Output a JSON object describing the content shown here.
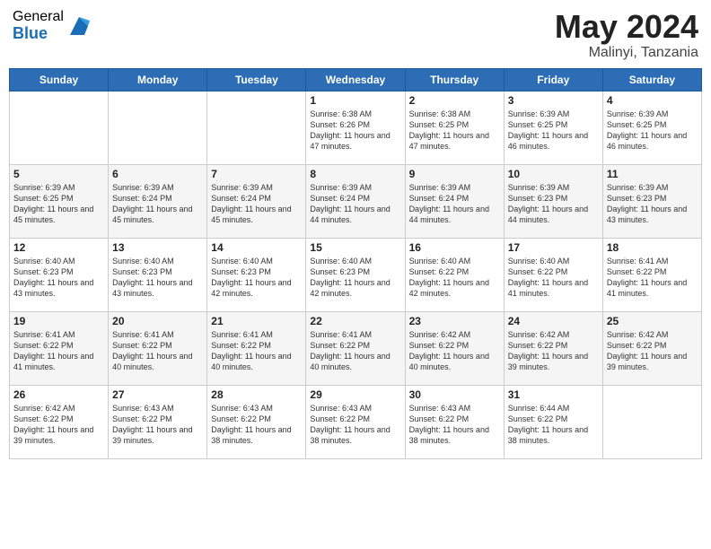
{
  "logo": {
    "general": "General",
    "blue": "Blue"
  },
  "title": {
    "month": "May 2024",
    "location": "Malinyi, Tanzania"
  },
  "headers": [
    "Sunday",
    "Monday",
    "Tuesday",
    "Wednesday",
    "Thursday",
    "Friday",
    "Saturday"
  ],
  "weeks": [
    [
      {
        "day": "",
        "text": ""
      },
      {
        "day": "",
        "text": ""
      },
      {
        "day": "",
        "text": ""
      },
      {
        "day": "1",
        "text": "Sunrise: 6:38 AM\nSunset: 6:26 PM\nDaylight: 11 hours\nand 47 minutes."
      },
      {
        "day": "2",
        "text": "Sunrise: 6:38 AM\nSunset: 6:25 PM\nDaylight: 11 hours\nand 47 minutes."
      },
      {
        "day": "3",
        "text": "Sunrise: 6:39 AM\nSunset: 6:25 PM\nDaylight: 11 hours\nand 46 minutes."
      },
      {
        "day": "4",
        "text": "Sunrise: 6:39 AM\nSunset: 6:25 PM\nDaylight: 11 hours\nand 46 minutes."
      }
    ],
    [
      {
        "day": "5",
        "text": "Sunrise: 6:39 AM\nSunset: 6:25 PM\nDaylight: 11 hours\nand 45 minutes."
      },
      {
        "day": "6",
        "text": "Sunrise: 6:39 AM\nSunset: 6:24 PM\nDaylight: 11 hours\nand 45 minutes."
      },
      {
        "day": "7",
        "text": "Sunrise: 6:39 AM\nSunset: 6:24 PM\nDaylight: 11 hours\nand 45 minutes."
      },
      {
        "day": "8",
        "text": "Sunrise: 6:39 AM\nSunset: 6:24 PM\nDaylight: 11 hours\nand 44 minutes."
      },
      {
        "day": "9",
        "text": "Sunrise: 6:39 AM\nSunset: 6:24 PM\nDaylight: 11 hours\nand 44 minutes."
      },
      {
        "day": "10",
        "text": "Sunrise: 6:39 AM\nSunset: 6:23 PM\nDaylight: 11 hours\nand 44 minutes."
      },
      {
        "day": "11",
        "text": "Sunrise: 6:39 AM\nSunset: 6:23 PM\nDaylight: 11 hours\nand 43 minutes."
      }
    ],
    [
      {
        "day": "12",
        "text": "Sunrise: 6:40 AM\nSunset: 6:23 PM\nDaylight: 11 hours\nand 43 minutes."
      },
      {
        "day": "13",
        "text": "Sunrise: 6:40 AM\nSunset: 6:23 PM\nDaylight: 11 hours\nand 43 minutes."
      },
      {
        "day": "14",
        "text": "Sunrise: 6:40 AM\nSunset: 6:23 PM\nDaylight: 11 hours\nand 42 minutes."
      },
      {
        "day": "15",
        "text": "Sunrise: 6:40 AM\nSunset: 6:23 PM\nDaylight: 11 hours\nand 42 minutes."
      },
      {
        "day": "16",
        "text": "Sunrise: 6:40 AM\nSunset: 6:22 PM\nDaylight: 11 hours\nand 42 minutes."
      },
      {
        "day": "17",
        "text": "Sunrise: 6:40 AM\nSunset: 6:22 PM\nDaylight: 11 hours\nand 41 minutes."
      },
      {
        "day": "18",
        "text": "Sunrise: 6:41 AM\nSunset: 6:22 PM\nDaylight: 11 hours\nand 41 minutes."
      }
    ],
    [
      {
        "day": "19",
        "text": "Sunrise: 6:41 AM\nSunset: 6:22 PM\nDaylight: 11 hours\nand 41 minutes."
      },
      {
        "day": "20",
        "text": "Sunrise: 6:41 AM\nSunset: 6:22 PM\nDaylight: 11 hours\nand 40 minutes."
      },
      {
        "day": "21",
        "text": "Sunrise: 6:41 AM\nSunset: 6:22 PM\nDaylight: 11 hours\nand 40 minutes."
      },
      {
        "day": "22",
        "text": "Sunrise: 6:41 AM\nSunset: 6:22 PM\nDaylight: 11 hours\nand 40 minutes."
      },
      {
        "day": "23",
        "text": "Sunrise: 6:42 AM\nSunset: 6:22 PM\nDaylight: 11 hours\nand 40 minutes."
      },
      {
        "day": "24",
        "text": "Sunrise: 6:42 AM\nSunset: 6:22 PM\nDaylight: 11 hours\nand 39 minutes."
      },
      {
        "day": "25",
        "text": "Sunrise: 6:42 AM\nSunset: 6:22 PM\nDaylight: 11 hours\nand 39 minutes."
      }
    ],
    [
      {
        "day": "26",
        "text": "Sunrise: 6:42 AM\nSunset: 6:22 PM\nDaylight: 11 hours\nand 39 minutes."
      },
      {
        "day": "27",
        "text": "Sunrise: 6:43 AM\nSunset: 6:22 PM\nDaylight: 11 hours\nand 39 minutes."
      },
      {
        "day": "28",
        "text": "Sunrise: 6:43 AM\nSunset: 6:22 PM\nDaylight: 11 hours\nand 38 minutes."
      },
      {
        "day": "29",
        "text": "Sunrise: 6:43 AM\nSunset: 6:22 PM\nDaylight: 11 hours\nand 38 minutes."
      },
      {
        "day": "30",
        "text": "Sunrise: 6:43 AM\nSunset: 6:22 PM\nDaylight: 11 hours\nand 38 minutes."
      },
      {
        "day": "31",
        "text": "Sunrise: 6:44 AM\nSunset: 6:22 PM\nDaylight: 11 hours\nand 38 minutes."
      },
      {
        "day": "",
        "text": ""
      }
    ]
  ]
}
